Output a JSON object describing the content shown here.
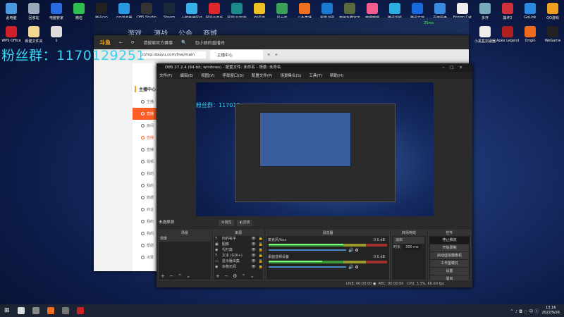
{
  "desktop": {
    "top_icons": [
      {
        "label": "此电脑",
        "color": "#4a9ae0"
      },
      {
        "label": "回收站",
        "color": "#9ab"
      },
      {
        "label": "电脑管家",
        "color": "#2a6adf"
      },
      {
        "label": "微信",
        "color": "#2fbf4f"
      },
      {
        "label": "腾讯QQ",
        "color": "#222"
      },
      {
        "label": "QQ浏览器",
        "color": "#2a9ae0"
      },
      {
        "label": "OBS Studio",
        "color": "#333"
      },
      {
        "label": "Steam",
        "color": "#1b2838"
      },
      {
        "label": "小鹅声律驱动",
        "color": "#3ab0e8"
      },
      {
        "label": "网易云音乐",
        "color": "#e0282c"
      },
      {
        "label": "网易UU加速",
        "color": "#1a8a8a"
      },
      {
        "label": "YY语音",
        "color": "#f0c020"
      },
      {
        "label": "鼠大侠",
        "color": "#3aa05a"
      },
      {
        "label": "斗鱼直播",
        "color": "#f07020"
      },
      {
        "label": "暴雪战网",
        "color": "#1a7ad0"
      },
      {
        "label": "魔兽争霸官方",
        "color": "#5a6a3a"
      },
      {
        "label": "哔哩哔哩",
        "color": "#f25d8e"
      },
      {
        "label": "腾讯视频",
        "color": "#2ab0e0"
      },
      {
        "label": "腾讯文档",
        "color": "#1a6adf"
      },
      {
        "label": "百度网盘",
        "color": "#3a8ae0"
      },
      {
        "label": "Bongo Cat",
        "color": "#eee"
      },
      {
        "label": "多开",
        "color": "#7ab"
      },
      {
        "label": "崩坏2",
        "color": "#d0303a"
      },
      {
        "label": "GoLink",
        "color": "#2a8ae0"
      },
      {
        "label": "QQ游戏",
        "color": "#f0a020"
      }
    ],
    "second_row_left": [
      {
        "label": "WPS Office",
        "color": "#d0202a"
      },
      {
        "label": "新建文件夹",
        "color": "#f0d890"
      },
      {
        "label": "1",
        "color": "#ddd"
      }
    ],
    "second_row_right": [
      {
        "label": "小黑盒加速器",
        "color": "#eee"
      },
      {
        "label": "Apex Legends",
        "color": "#b02020"
      },
      {
        "label": "Origin",
        "color": "#f06a20"
      },
      {
        "label": "WeGame",
        "color": "#222"
      }
    ],
    "fans_text": "粉丝群：1170129251"
  },
  "launcher": {
    "nav": [
      "游戏",
      "源战",
      "公会",
      "商城"
    ],
    "ping": "25ms"
  },
  "browser": {
    "tabs": [
      "斗鱼",
      "←",
      "⟳",
      "请搜索官方赛事",
      "🔍",
      "包小邪的直播间"
    ],
    "url": "c//mp.douyu.com/live/main",
    "tab_title": "主播中心",
    "tab_close": "×",
    "new_tab": "+",
    "sidebar_title": "主播中心",
    "sidebar": [
      {
        "label": "主播",
        "state": ""
      },
      {
        "label": "直播",
        "state": "act"
      },
      {
        "label": "房间",
        "state": ""
      },
      {
        "label": "直播",
        "state": "red"
      },
      {
        "label": "直播",
        "state": ""
      },
      {
        "label": "视频",
        "state": ""
      },
      {
        "label": "我的",
        "state": ""
      },
      {
        "label": "我的",
        "state": ""
      },
      {
        "label": "数据",
        "state": ""
      },
      {
        "label": "商业",
        "state": ""
      },
      {
        "label": "我的",
        "state": ""
      },
      {
        "label": "我的",
        "state": ""
      },
      {
        "label": "帮助",
        "state": ""
      },
      {
        "label": "点赞",
        "state": ""
      }
    ]
  },
  "obs": {
    "title": "OBS 27.2.4 (64-bit, windows) - 配置文件: 未命名 - 场景: 未命名",
    "menu": [
      "文件(F)",
      "编辑(E)",
      "视图(V)",
      "停靠窗口(D)",
      "配置文件(P)",
      "场景集合(S)",
      "工具(T)",
      "帮助(H)"
    ],
    "preview_fans": "粉丝群：117012",
    "no_source": "未选择源",
    "props_btn": "⚙属性",
    "filter_btn": "◐滤镜",
    "scenes": {
      "title": "场景",
      "items": [
        "场景"
      ]
    },
    "sources": {
      "title": "来源",
      "items": [
        {
          "icon": "T",
          "label": "你的名字"
        },
        {
          "icon": "▣",
          "label": "图像"
        },
        {
          "icon": "◉",
          "label": "代打篇"
        },
        {
          "icon": "T",
          "label": "文本 (GDI+)"
        },
        {
          "icon": "▭",
          "label": "显示器采集"
        },
        {
          "icon": "◉",
          "label": "杂物无闻"
        }
      ]
    },
    "mixer": {
      "title": "混音器",
      "tracks": [
        {
          "name": "麦克风/Aux",
          "db": "0.0 dB",
          "level": 0.63
        },
        {
          "name": "桌面音频设备",
          "db": "0.0 dB",
          "level": 0.45
        }
      ]
    },
    "transitions": {
      "title": "转场特效",
      "type": "淡出",
      "duration_label": "时长",
      "duration": "300 ms"
    },
    "controls": {
      "title": "控件",
      "buttons": [
        "停止推流",
        "开始录制",
        "启动虚拟摄像机",
        "工作室模式",
        "设置",
        "退出"
      ]
    },
    "status": {
      "live": "LIVE: 00:00:00",
      "rec": "REC: 00:00:00",
      "cpu": "CPU: 3.3%, 60.00 fps"
    }
  },
  "taskbar": {
    "time": "13:16",
    "date": "2022/9/26",
    "apps": [
      "#ddd",
      "#888",
      "#f07020",
      "#777",
      "#c22"
    ],
    "tray": "^ ♪ ◘ ◌ 中 ⓢ"
  }
}
